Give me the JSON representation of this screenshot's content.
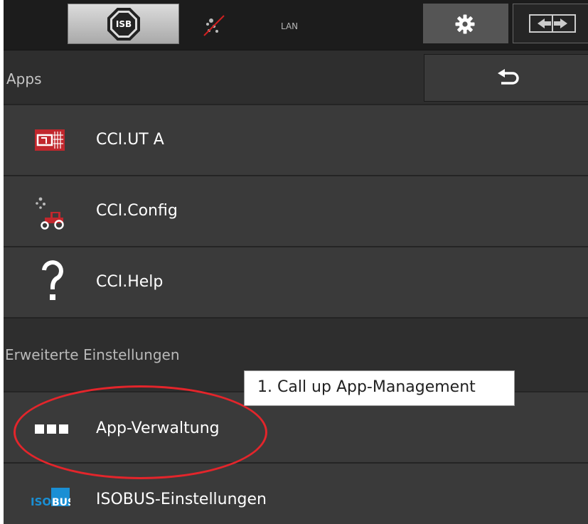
{
  "topbar": {
    "isb_label": "ISB",
    "gps_icon": "gps-off-icon",
    "lan_label": "LAN",
    "settings_icon": "gear-icon",
    "switch_icon": "switch-screen-icon"
  },
  "header": {
    "title": "Apps",
    "back_icon": "back-arrow-icon"
  },
  "apps": [
    {
      "label": "CCI.UT A",
      "icon": "ut-terminal-icon"
    },
    {
      "label": "CCI.Config",
      "icon": "config-tractor-icon"
    },
    {
      "label": "CCI.Help",
      "icon": "question-mark-icon"
    }
  ],
  "advanced": {
    "section_label": "Erweiterte Einstellungen",
    "items": [
      {
        "label": "App-Verwaltung",
        "icon": "app-management-icon"
      },
      {
        "label": "ISOBUS-Einstellungen",
        "icon": "isobus-icon",
        "icon_text": "ISOBUS"
      }
    ]
  },
  "annotation": {
    "callout_text": "1. Call up App-Management"
  },
  "colors": {
    "background": "#2e2e2e",
    "row": "#3a3a3a",
    "highlight": "#e3252b",
    "ut_icon_red": "#c1272d",
    "isobus_blue": "#1a8fd4"
  }
}
